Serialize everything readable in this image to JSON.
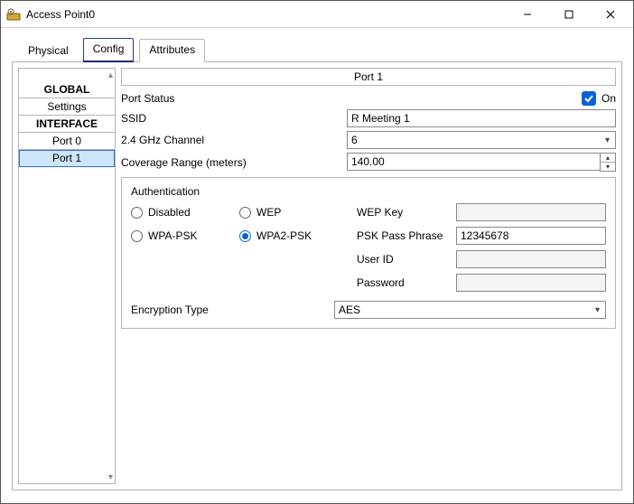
{
  "window": {
    "title": "Access Point0"
  },
  "tabs": {
    "physical": "Physical",
    "config": "Config",
    "attributes": "Attributes"
  },
  "nav": {
    "global_header": "GLOBAL",
    "settings": "Settings",
    "interface_header": "INTERFACE",
    "port0": "Port 0",
    "port1": "Port 1"
  },
  "panel": {
    "title": "Port 1",
    "port_status_label": "Port Status",
    "port_status_on": "On",
    "port_status_checked": true,
    "ssid_label": "SSID",
    "ssid_value": "R Meeting 1",
    "channel_label": "2.4 GHz Channel",
    "channel_value": "6",
    "coverage_label": "Coverage Range (meters)",
    "coverage_value": "140.00"
  },
  "auth": {
    "group_label": "Authentication",
    "disabled": "Disabled",
    "wep": "WEP",
    "wpa_psk": "WPA-PSK",
    "wpa2_psk": "WPA2-PSK",
    "selected": "wpa2_psk",
    "wep_key_label": "WEP Key",
    "wep_key_value": "",
    "psk_label": "PSK Pass Phrase",
    "psk_value": "12345678",
    "userid_label": "User ID",
    "userid_value": "",
    "password_label": "Password",
    "password_value": "",
    "enc_label": "Encryption Type",
    "enc_value": "AES"
  }
}
